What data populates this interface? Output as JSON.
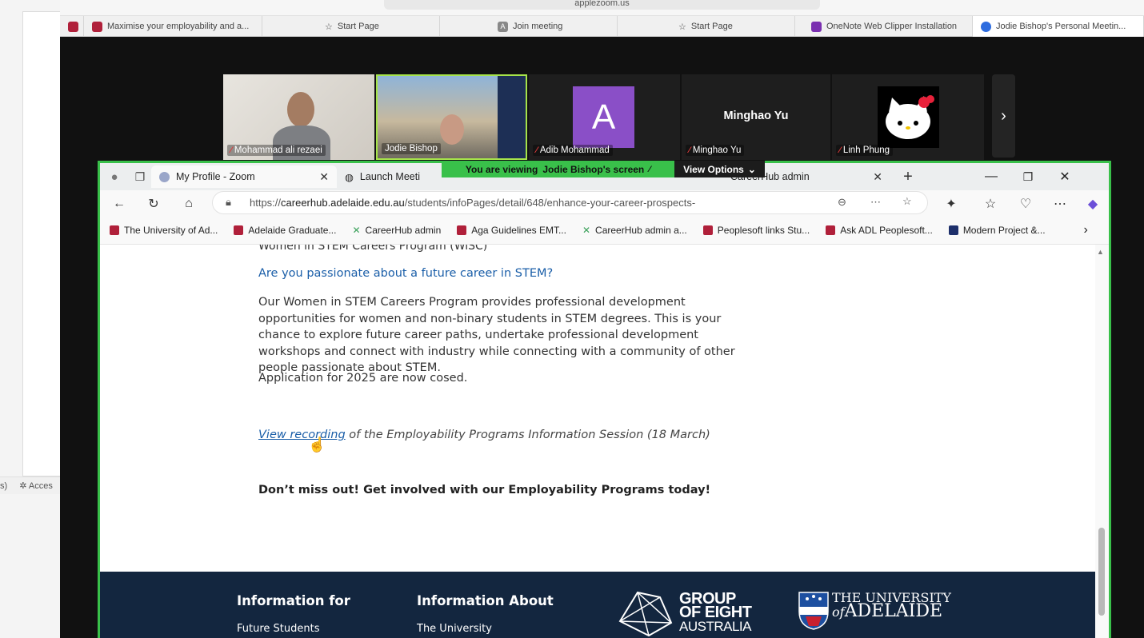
{
  "outer_browser": {
    "url_partial": "applezoom.us",
    "tabs": [
      {
        "label": "Maximise your employability and a...",
        "icon": "adelaide-crest-icon"
      },
      {
        "label": "Start Page",
        "icon": "star-icon"
      },
      {
        "label": "Join meeting",
        "icon": "a-app-icon"
      },
      {
        "label": "Start Page",
        "icon": "star-icon"
      },
      {
        "label": "OneNote Web Clipper Installation",
        "icon": "onenote-icon"
      },
      {
        "label": "Jodie Bishop's Personal Meetin...",
        "icon": "zoom-icon",
        "active": true
      }
    ]
  },
  "left_panel": {
    "status_fragment": "s)",
    "accessibility": "Acces"
  },
  "zoom": {
    "participants": [
      {
        "name": "Mohammad ali rezaei",
        "muted": true,
        "video": true
      },
      {
        "name": "Jodie Bishop",
        "muted": false,
        "video": true,
        "active_speaker": true
      },
      {
        "name": "Adib Mohammad",
        "muted": true,
        "avatar_letter": "A",
        "avatar_color": "#8a4fc7"
      },
      {
        "name": "Minghao Yu",
        "muted": true,
        "display_name": "Minghao Yu"
      },
      {
        "name": "Linh Phung",
        "muted": true,
        "avatar": "hello-kitty"
      }
    ],
    "banner": {
      "prefix": "You are viewing",
      "screen_owner": "Jodie Bishop's screen",
      "options": "View Options"
    },
    "accent": "#39c04a"
  },
  "edge": {
    "tabs": [
      {
        "label": "My Profile - Zoom",
        "icon": "zoom-icon"
      },
      {
        "label": "Launch Meeti",
        "icon": "globe-icon"
      },
      {
        "label": "CareerHub admin",
        "icon": "careerhub-icon"
      }
    ],
    "url_prefix": "https://",
    "url_host": "careerhub.adelaide.edu.au",
    "url_path": "/students/infoPages/detail/648/enhance-your-career-prospects-",
    "favorites": [
      {
        "label": "The University of Ad...",
        "icon": "adelaide-crest-icon"
      },
      {
        "label": "Adelaide Graduate...",
        "icon": "adelaide-crest-icon"
      },
      {
        "label": "CareerHub admin",
        "icon": "careerhub-icon"
      },
      {
        "label": "Aga Guidelines EMT...",
        "icon": "adelaide-crest-icon"
      },
      {
        "label": "CareerHub admin a...",
        "icon": "careerhub-icon"
      },
      {
        "label": "Peoplesoft links Stu...",
        "icon": "adelaide-crest-icon"
      },
      {
        "label": "Ask ADL Peoplesoft...",
        "icon": "adelaide-crest-icon"
      },
      {
        "label": "Modern Project &...",
        "icon": "vcheck-icon"
      }
    ]
  },
  "page": {
    "cut_heading": "Women in STEM Careers Program (WiSC)",
    "question": "Are you passionate about a future career in STEM?",
    "paragraph": "Our Women in STEM Careers Program provides professional development opportunities for women and non-binary students in STEM degrees. This is your chance to explore future career paths, undertake professional development workshops and connect with industry while connecting with a community of other people passionate about STEM.",
    "closed_notice": "Application for 2025 are now cosed.",
    "recording_link": "View recording",
    "recording_rest": " of the Employability Programs Information Session (18 March)",
    "cta": "Don’t miss out! Get involved with our Employability Programs today!",
    "link_color": "#1a5ea8"
  },
  "footer": {
    "col1_heading": "Information for",
    "col1_link": "Future Students",
    "col2_heading": "Information About",
    "col2_link": "The University",
    "go8_line1": "GROUP",
    "go8_line2": "OF EIGHT",
    "go8_line3": "AUSTRALIA",
    "uoa_line1": "THE UNIVERSITY",
    "uoa_line2_of": "of",
    "uoa_line2_name": "ADELAIDE",
    "bg": "#13263f"
  }
}
